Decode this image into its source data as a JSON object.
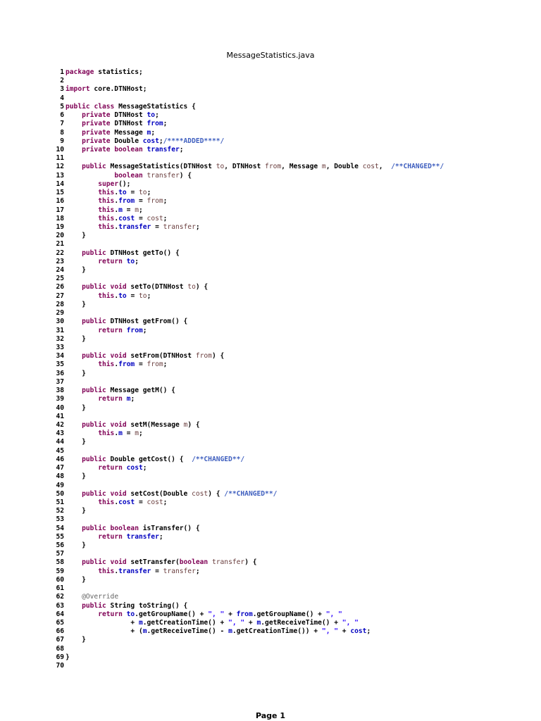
{
  "document": {
    "title": "MessageStatistics.java",
    "footer": "Page 1"
  },
  "code_lines": [
    [
      [
        "kw",
        "package"
      ],
      [
        "txt",
        " statistics;"
      ]
    ],
    [],
    [
      [
        "kw",
        "import"
      ],
      [
        "txt",
        " core.DTNHost;"
      ]
    ],
    [],
    [
      [
        "kw",
        "public"
      ],
      [
        "txt",
        " "
      ],
      [
        "kw",
        "class"
      ],
      [
        "txt",
        " MessageStatistics {"
      ]
    ],
    [
      [
        "txt",
        "    "
      ],
      [
        "kw",
        "private"
      ],
      [
        "txt",
        " DTNHost "
      ],
      [
        "fld",
        "to"
      ],
      [
        "txt",
        ";"
      ]
    ],
    [
      [
        "txt",
        "    "
      ],
      [
        "kw",
        "private"
      ],
      [
        "txt",
        " DTNHost "
      ],
      [
        "fld",
        "from"
      ],
      [
        "txt",
        ";"
      ]
    ],
    [
      [
        "txt",
        "    "
      ],
      [
        "kw",
        "private"
      ],
      [
        "txt",
        " Message "
      ],
      [
        "fld",
        "m"
      ],
      [
        "txt",
        ";"
      ]
    ],
    [
      [
        "txt",
        "    "
      ],
      [
        "kw",
        "private"
      ],
      [
        "txt",
        " Double "
      ],
      [
        "fld",
        "cost"
      ],
      [
        "txt",
        ";"
      ],
      [
        "cm",
        "/****ADDED****/"
      ]
    ],
    [
      [
        "txt",
        "    "
      ],
      [
        "kw",
        "private"
      ],
      [
        "txt",
        " "
      ],
      [
        "kw",
        "boolean"
      ],
      [
        "txt",
        " "
      ],
      [
        "fld",
        "transfer"
      ],
      [
        "txt",
        ";"
      ]
    ],
    [],
    [
      [
        "txt",
        "    "
      ],
      [
        "kw",
        "public"
      ],
      [
        "txt",
        " MessageStatistics(DTNHost "
      ],
      [
        "par",
        "to"
      ],
      [
        "txt",
        ", DTNHost "
      ],
      [
        "par",
        "from"
      ],
      [
        "txt",
        ", Message "
      ],
      [
        "par",
        "m"
      ],
      [
        "txt",
        ", Double "
      ],
      [
        "par",
        "cost"
      ],
      [
        "txt",
        ",  "
      ],
      [
        "cm",
        "/**CHANGED**/"
      ]
    ],
    [
      [
        "txt",
        "            "
      ],
      [
        "kw",
        "boolean"
      ],
      [
        "txt",
        " "
      ],
      [
        "par",
        "transfer"
      ],
      [
        "txt",
        ") {"
      ]
    ],
    [
      [
        "txt",
        "        "
      ],
      [
        "kw",
        "super"
      ],
      [
        "txt",
        "();"
      ]
    ],
    [
      [
        "txt",
        "        "
      ],
      [
        "kw",
        "this"
      ],
      [
        "txt",
        "."
      ],
      [
        "fld",
        "to"
      ],
      [
        "txt",
        " = "
      ],
      [
        "par",
        "to"
      ],
      [
        "txt",
        ";"
      ]
    ],
    [
      [
        "txt",
        "        "
      ],
      [
        "kw",
        "this"
      ],
      [
        "txt",
        "."
      ],
      [
        "fld",
        "from"
      ],
      [
        "txt",
        " = "
      ],
      [
        "par",
        "from"
      ],
      [
        "txt",
        ";"
      ]
    ],
    [
      [
        "txt",
        "        "
      ],
      [
        "kw",
        "this"
      ],
      [
        "txt",
        "."
      ],
      [
        "fld",
        "m"
      ],
      [
        "txt",
        " = "
      ],
      [
        "par",
        "m"
      ],
      [
        "txt",
        ";"
      ]
    ],
    [
      [
        "txt",
        "        "
      ],
      [
        "kw",
        "this"
      ],
      [
        "txt",
        "."
      ],
      [
        "fld",
        "cost"
      ],
      [
        "txt",
        " = "
      ],
      [
        "par",
        "cost"
      ],
      [
        "txt",
        ";"
      ]
    ],
    [
      [
        "txt",
        "        "
      ],
      [
        "kw",
        "this"
      ],
      [
        "txt",
        "."
      ],
      [
        "fld",
        "transfer"
      ],
      [
        "txt",
        " = "
      ],
      [
        "par",
        "transfer"
      ],
      [
        "txt",
        ";"
      ]
    ],
    [
      [
        "txt",
        "    }"
      ]
    ],
    [],
    [
      [
        "txt",
        "    "
      ],
      [
        "kw",
        "public"
      ],
      [
        "txt",
        " DTNHost getTo() {"
      ]
    ],
    [
      [
        "txt",
        "        "
      ],
      [
        "kw",
        "return"
      ],
      [
        "txt",
        " "
      ],
      [
        "fld",
        "to"
      ],
      [
        "txt",
        ";"
      ]
    ],
    [
      [
        "txt",
        "    }"
      ]
    ],
    [],
    [
      [
        "txt",
        "    "
      ],
      [
        "kw",
        "public"
      ],
      [
        "txt",
        " "
      ],
      [
        "kw",
        "void"
      ],
      [
        "txt",
        " setTo(DTNHost "
      ],
      [
        "par",
        "to"
      ],
      [
        "txt",
        ") {"
      ]
    ],
    [
      [
        "txt",
        "        "
      ],
      [
        "kw",
        "this"
      ],
      [
        "txt",
        "."
      ],
      [
        "fld",
        "to"
      ],
      [
        "txt",
        " = "
      ],
      [
        "par",
        "to"
      ],
      [
        "txt",
        ";"
      ]
    ],
    [
      [
        "txt",
        "    }"
      ]
    ],
    [],
    [
      [
        "txt",
        "    "
      ],
      [
        "kw",
        "public"
      ],
      [
        "txt",
        " DTNHost getFrom() {"
      ]
    ],
    [
      [
        "txt",
        "        "
      ],
      [
        "kw",
        "return"
      ],
      [
        "txt",
        " "
      ],
      [
        "fld",
        "from"
      ],
      [
        "txt",
        ";"
      ]
    ],
    [
      [
        "txt",
        "    }"
      ]
    ],
    [],
    [
      [
        "txt",
        "    "
      ],
      [
        "kw",
        "public"
      ],
      [
        "txt",
        " "
      ],
      [
        "kw",
        "void"
      ],
      [
        "txt",
        " setFrom(DTNHost "
      ],
      [
        "par",
        "from"
      ],
      [
        "txt",
        ") {"
      ]
    ],
    [
      [
        "txt",
        "        "
      ],
      [
        "kw",
        "this"
      ],
      [
        "txt",
        "."
      ],
      [
        "fld",
        "from"
      ],
      [
        "txt",
        " = "
      ],
      [
        "par",
        "from"
      ],
      [
        "txt",
        ";"
      ]
    ],
    [
      [
        "txt",
        "    }"
      ]
    ],
    [],
    [
      [
        "txt",
        "    "
      ],
      [
        "kw",
        "public"
      ],
      [
        "txt",
        " Message getM() {"
      ]
    ],
    [
      [
        "txt",
        "        "
      ],
      [
        "kw",
        "return"
      ],
      [
        "txt",
        " "
      ],
      [
        "fld",
        "m"
      ],
      [
        "txt",
        ";"
      ]
    ],
    [
      [
        "txt",
        "    }"
      ]
    ],
    [],
    [
      [
        "txt",
        "    "
      ],
      [
        "kw",
        "public"
      ],
      [
        "txt",
        " "
      ],
      [
        "kw",
        "void"
      ],
      [
        "txt",
        " setM(Message "
      ],
      [
        "par",
        "m"
      ],
      [
        "txt",
        ") {"
      ]
    ],
    [
      [
        "txt",
        "        "
      ],
      [
        "kw",
        "this"
      ],
      [
        "txt",
        "."
      ],
      [
        "fld",
        "m"
      ],
      [
        "txt",
        " = "
      ],
      [
        "par",
        "m"
      ],
      [
        "txt",
        ";"
      ]
    ],
    [
      [
        "txt",
        "    }"
      ]
    ],
    [],
    [
      [
        "txt",
        "    "
      ],
      [
        "kw",
        "public"
      ],
      [
        "txt",
        " Double getCost() {  "
      ],
      [
        "cm",
        "/**CHANGED**/"
      ]
    ],
    [
      [
        "txt",
        "        "
      ],
      [
        "kw",
        "return"
      ],
      [
        "txt",
        " "
      ],
      [
        "fld",
        "cost"
      ],
      [
        "txt",
        ";"
      ]
    ],
    [
      [
        "txt",
        "    }"
      ]
    ],
    [],
    [
      [
        "txt",
        "    "
      ],
      [
        "kw",
        "public"
      ],
      [
        "txt",
        " "
      ],
      [
        "kw",
        "void"
      ],
      [
        "txt",
        " setCost(Double "
      ],
      [
        "par",
        "cost"
      ],
      [
        "txt",
        ") { "
      ],
      [
        "cm",
        "/**CHANGED**/"
      ]
    ],
    [
      [
        "txt",
        "        "
      ],
      [
        "kw",
        "this"
      ],
      [
        "txt",
        "."
      ],
      [
        "fld",
        "cost"
      ],
      [
        "txt",
        " = "
      ],
      [
        "par",
        "cost"
      ],
      [
        "txt",
        ";"
      ]
    ],
    [
      [
        "txt",
        "    }"
      ]
    ],
    [],
    [
      [
        "txt",
        "    "
      ],
      [
        "kw",
        "public"
      ],
      [
        "txt",
        " "
      ],
      [
        "kw",
        "boolean"
      ],
      [
        "txt",
        " isTransfer() {"
      ]
    ],
    [
      [
        "txt",
        "        "
      ],
      [
        "kw",
        "return"
      ],
      [
        "txt",
        " "
      ],
      [
        "fld",
        "transfer"
      ],
      [
        "txt",
        ";"
      ]
    ],
    [
      [
        "txt",
        "    }"
      ]
    ],
    [],
    [
      [
        "txt",
        "    "
      ],
      [
        "kw",
        "public"
      ],
      [
        "txt",
        " "
      ],
      [
        "kw",
        "void"
      ],
      [
        "txt",
        " setTransfer("
      ],
      [
        "kw",
        "boolean"
      ],
      [
        "txt",
        " "
      ],
      [
        "par",
        "transfer"
      ],
      [
        "txt",
        ") {"
      ]
    ],
    [
      [
        "txt",
        "        "
      ],
      [
        "kw",
        "this"
      ],
      [
        "txt",
        "."
      ],
      [
        "fld",
        "transfer"
      ],
      [
        "txt",
        " = "
      ],
      [
        "par",
        "transfer"
      ],
      [
        "txt",
        ";"
      ]
    ],
    [
      [
        "txt",
        "    }"
      ]
    ],
    [],
    [
      [
        "txt",
        "    "
      ],
      [
        "ann",
        "@Override"
      ]
    ],
    [
      [
        "txt",
        "    "
      ],
      [
        "kw",
        "public"
      ],
      [
        "txt",
        " String toString() {"
      ]
    ],
    [
      [
        "txt",
        "        "
      ],
      [
        "kw",
        "return"
      ],
      [
        "txt",
        " "
      ],
      [
        "fld",
        "to"
      ],
      [
        "txt",
        ".getGroupName() + "
      ],
      [
        "str",
        "\", \""
      ],
      [
        "txt",
        " + "
      ],
      [
        "fld",
        "from"
      ],
      [
        "txt",
        ".getGroupName() + "
      ],
      [
        "str",
        "\", \""
      ]
    ],
    [
      [
        "txt",
        "                + "
      ],
      [
        "fld",
        "m"
      ],
      [
        "txt",
        ".getCreationTime() + "
      ],
      [
        "str",
        "\", \""
      ],
      [
        "txt",
        " + "
      ],
      [
        "fld",
        "m"
      ],
      [
        "txt",
        ".getReceiveTime() + "
      ],
      [
        "str",
        "\", \""
      ]
    ],
    [
      [
        "txt",
        "                + ("
      ],
      [
        "fld",
        "m"
      ],
      [
        "txt",
        ".getReceiveTime() - "
      ],
      [
        "fld",
        "m"
      ],
      [
        "txt",
        ".getCreationTime()) + "
      ],
      [
        "str",
        "\", \""
      ],
      [
        "txt",
        " + "
      ],
      [
        "fld",
        "cost"
      ],
      [
        "txt",
        ";"
      ]
    ],
    [
      [
        "txt",
        "    }"
      ]
    ],
    [],
    [
      [
        "txt",
        "}"
      ]
    ],
    []
  ]
}
